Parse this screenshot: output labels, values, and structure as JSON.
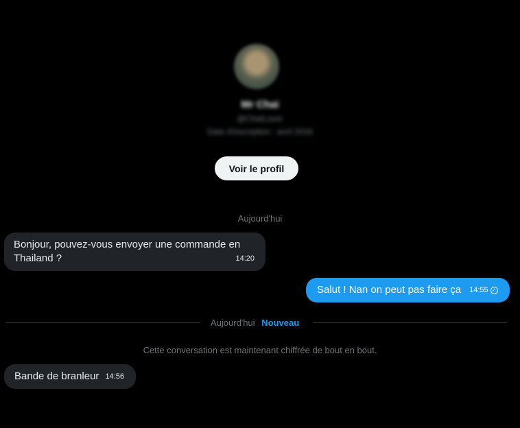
{
  "profile": {
    "name": "Mr Chai",
    "handle": "@ChaiLover",
    "joined": "Date d'inscription : avril 2016",
    "view_profile_button": "Voir le profil"
  },
  "day_label": "Aujourd'hui",
  "messages": [
    {
      "direction": "incoming",
      "text": "Bonjour, pouvez-vous envoyer une commande en Thailand ?",
      "time": "14:20"
    },
    {
      "direction": "outgoing",
      "text": "Salut ! Nan on peut pas faire ça",
      "time": "14:55",
      "status_icon": "check-circle-icon"
    },
    {
      "direction": "incoming",
      "text": "Bande de branleur",
      "time": "14:56"
    }
  ],
  "new_divider": {
    "label": "Aujourd'hui",
    "badge": "Nouveau"
  },
  "encryption_notice": "Cette conversation est maintenant chiffrée de bout en bout.",
  "colors": {
    "accent": "#1d9bf0",
    "incoming_bubble": "#202327",
    "background": "#000000"
  }
}
